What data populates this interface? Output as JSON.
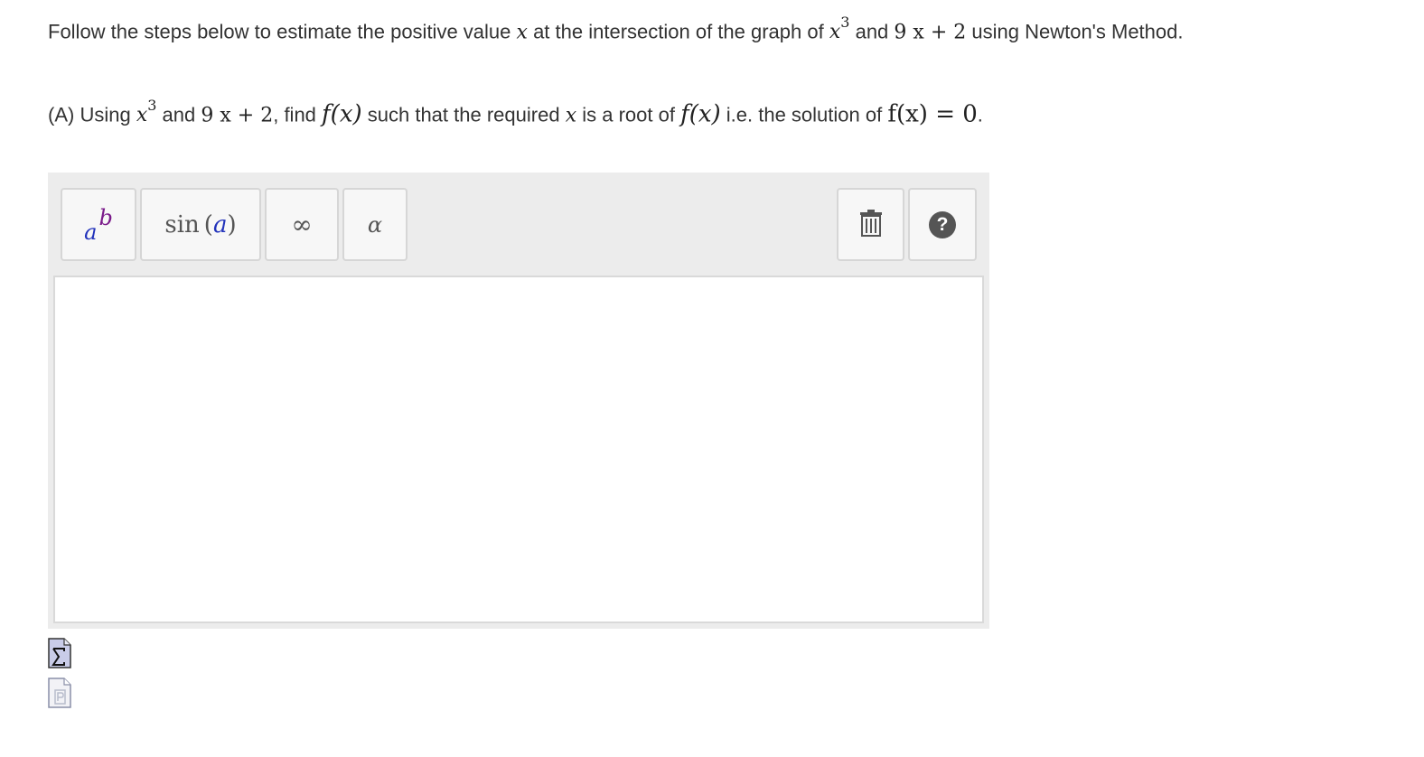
{
  "question": {
    "intro_prefix": "Follow the steps below to estimate the positive value",
    "intro_var": "x",
    "intro_middle": "at the intersection of the graph of",
    "expr1_base": "x",
    "expr1_exp": "3",
    "intro_and": "and",
    "expr2": "9 x + 2",
    "intro_suffix": "using Newton's Method.",
    "partA_prefix": "(A) Using",
    "partA_expr1_base": "x",
    "partA_expr1_exp": "3",
    "partA_and": "and",
    "partA_expr2": "9 x + 2",
    "partA_find": ", find",
    "partA_fx": "f(x)",
    "partA_such": "such that the required",
    "partA_var": "x",
    "partA_root": "is a root of",
    "partA_fx2": "f(x)",
    "partA_ie": "i.e. the solution of",
    "partA_eq": "f(x) = 0",
    "partA_period": "."
  },
  "toolbar": {
    "power_base": "a",
    "power_exp": "b",
    "sin_fn": "sin",
    "sin_open": "(",
    "sin_arg": "a",
    "sin_close": ")",
    "infinity": "∞",
    "alpha": "α",
    "help": "?"
  },
  "answer": {
    "value": ""
  },
  "colors": {
    "panel_bg": "#ececec",
    "button_bg": "#f7f7f7",
    "math_blue": "#2233bb",
    "math_purple": "#7a1a8a",
    "icon_gray": "#555555"
  },
  "icons": {
    "power": "superscript-icon",
    "sin": "sine-function-icon",
    "infinity": "infinity-icon",
    "alpha": "alpha-icon",
    "trash": "trash-icon",
    "help": "help-icon",
    "sigma": "equation-editor-icon",
    "pdf": "pdf-document-icon"
  }
}
